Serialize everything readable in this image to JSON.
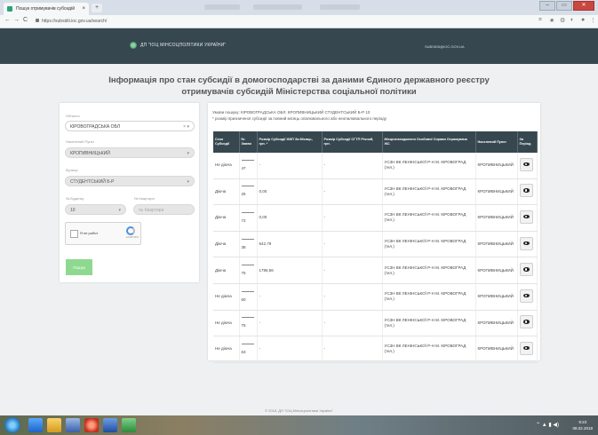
{
  "browser": {
    "tab_title": "Пошук отримувачів субсидій",
    "tab_close": "×",
    "new_tab": "+",
    "url": "https://subsidii.ioc.gov.ua/search/",
    "back": "←",
    "forward": "→",
    "reload": "C",
    "window_buttons": [
      "–",
      "▭",
      "✕"
    ]
  },
  "site": {
    "logo_text": "ДП \"ІОЦ МІНСОЦПОЛІТИКИ УКРАЇНИ\"",
    "email": "SUBSIDII@IOC.GOV.UA"
  },
  "page_title": "Інформація про стан субсидії в домогосподарстві за даними Єдиного державного реєстру отримувачів субсидій Міністерства соціальної політики",
  "form": {
    "region_label": "Область",
    "region_value": "КІРОВОГРАДСЬКА ОБЛ",
    "city_label": "Населений Пункт",
    "city_value": "КРОПИВНИЦЬКИЙ",
    "street_label": "Вулиця",
    "street_value": "СТУДЕНТСЬКИЙ Б-Р",
    "house_label": "№ Будинку",
    "house_value": "10",
    "apt_label": "№ Квартири",
    "apt_placeholder": "№ Квартири",
    "captcha_text": "Я не робот",
    "captcha_brand": "reCAPTCHA",
    "search_button": "Пошук"
  },
  "results": {
    "condition": "Умови пошуку: КІРОВОГРАДСЬКА ОБЛ. КРОПИВНИЦЬКИЙ СТУДЕНТСЬКИЙ Б-Р 10",
    "note": "* розмір призначеної субсидії за повний місяць опалювального або неопалювального періоду",
    "headers": [
      "Стан Субсидії",
      "№ Заяви",
      "Розмір Субсидії ЖКП За Місяць, грн. *",
      "Розмір Субсидії СГТП Річний, грн.",
      "Місцезнаходження Особової Справи Отримувача ЖС",
      "Населений Пункт",
      "За Період"
    ],
    "rows": [
      {
        "status": "Не діюча",
        "num": "47",
        "zkp": "-",
        "sgtp": "-",
        "loc": "УСЗН ВК ЛЕНІНСЬКОЇ Р-Н М. КІРОВОГРАД (тел.)",
        "city": "КРОПИВНИЦЬКИЙ"
      },
      {
        "status": "Діюча",
        "num": "25",
        "zkp": "0,00",
        "sgtp": "-",
        "loc": "УСЗН ВК ЛЕНІНСЬКОЇ Р-Н М. КІРОВОГРАД (тел.)",
        "city": "КРОПИВНИЦЬКИЙ"
      },
      {
        "status": "Діюча",
        "num": "72",
        "zkp": "0,00",
        "sgtp": "-",
        "loc": "УСЗН ВК ЛЕНІНСЬКОЇ Р-Н М. КІРОВОГРАД (тел.)",
        "city": "КРОПИВНИЦЬКИЙ"
      },
      {
        "status": "Діюча",
        "num": "38",
        "zkp": "642,79",
        "sgtp": "-",
        "loc": "УСЗН ВК ЛЕНІНСЬКОЇ Р-Н М. КІРОВОГРАД (тел.)",
        "city": "КРОПИВНИЦЬКИЙ"
      },
      {
        "status": "Діюча",
        "num": "75",
        "zkp": "1796,56",
        "sgtp": "-",
        "loc": "УСЗН ВК ЛЕНІНСЬКОЇ Р-Н М. КІРОВОГРАД (тел.)",
        "city": "КРОПИВНИЦЬКИЙ"
      },
      {
        "status": "Не діюча",
        "num": "60",
        "zkp": "-",
        "sgtp": "-",
        "loc": "УСЗН ВК ЛЕНІНСЬКОЇ Р-Н М. КІРОВОГРАД (тел.)",
        "city": "КРОПИВНИЦЬКИЙ"
      },
      {
        "status": "Не діюча",
        "num": "75",
        "zkp": "-",
        "sgtp": "-",
        "loc": "УСЗН ВК ЛЕНІНСЬКОЇ Р-Н М. КІРОВОГРАД (тел.)",
        "city": "КРОПИВНИЦЬКИЙ"
      },
      {
        "status": "Не діюча",
        "num": "63",
        "zkp": "-",
        "sgtp": "-",
        "loc": "УСЗН ВК ЛЕНІНСЬКОЇ Р-Н М. КІРОВОГРАД (тел.)",
        "city": "КРОПИВНИЦЬКИЙ"
      }
    ]
  },
  "footer": "© 2018, ДП \"ІОЦ Мінсоцполітики України\"",
  "taskbar": {
    "time": "9:23",
    "date": "08.02.2018"
  },
  "colors": {
    "header": "#37474f",
    "search_button": "#8ed98f",
    "background": "#eef0f1"
  }
}
